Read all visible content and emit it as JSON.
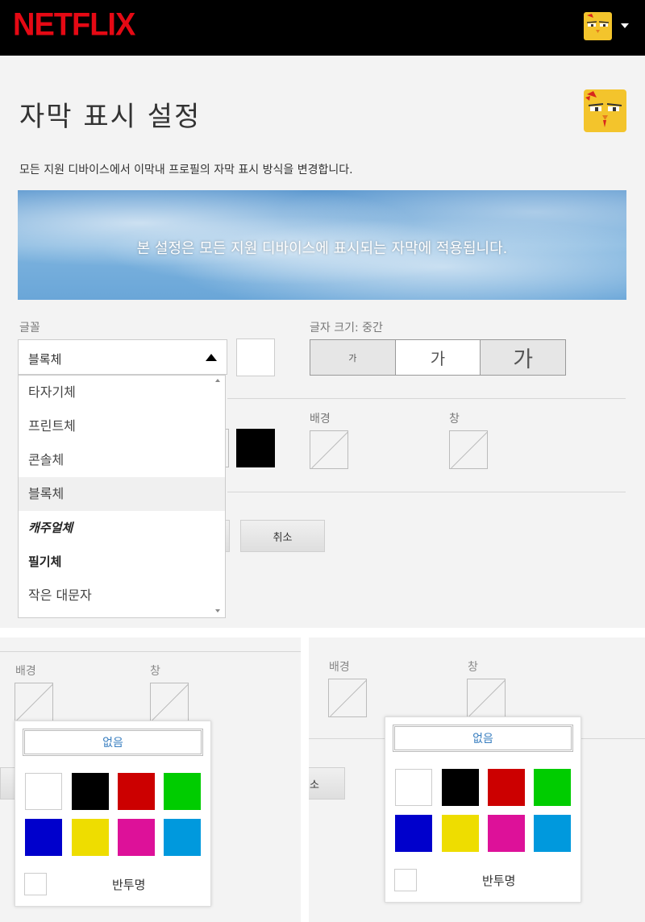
{
  "header": {
    "brand": "NETFLIX",
    "profile_icon": "chicken-avatar-icon",
    "menu_caret": "caret-down-icon"
  },
  "page": {
    "title": "자막 표시 설정",
    "description": "모든 지원 디바이스에서 이막내 프로필의 자막 표시 방식을 변경합니다.",
    "banner_text": "본 설정은 모든 지원 디바이스에 표시되는 자막에 적용됩니다."
  },
  "font": {
    "label": "글꼴",
    "selected": "블록체",
    "options": [
      "타자기체",
      "프린트체",
      "콘솔체",
      "블록체",
      "캐주얼체",
      "필기체",
      "작은 대문자"
    ],
    "selected_index": 3
  },
  "size": {
    "label": "글자 크기: 중간",
    "options": [
      "가",
      "가",
      "가"
    ],
    "selected_index": 1
  },
  "colors_section": {
    "background_label": "배경",
    "window_label": "창",
    "font_color": "#000000"
  },
  "buttons": {
    "cancel": "취소"
  },
  "color_popup": {
    "none_label": "없음",
    "colors": [
      "#ffffff",
      "#000000",
      "#cc0000",
      "#00cc00",
      "#0000cc",
      "#eedd00",
      "#dd1199",
      "#0099dd"
    ],
    "semi_transparent_label": "반투명"
  },
  "bottom_left": {
    "background_label": "배경",
    "window_label": "창"
  },
  "bottom_right": {
    "background_label": "배경",
    "window_label": "창",
    "partial_button": "소"
  }
}
